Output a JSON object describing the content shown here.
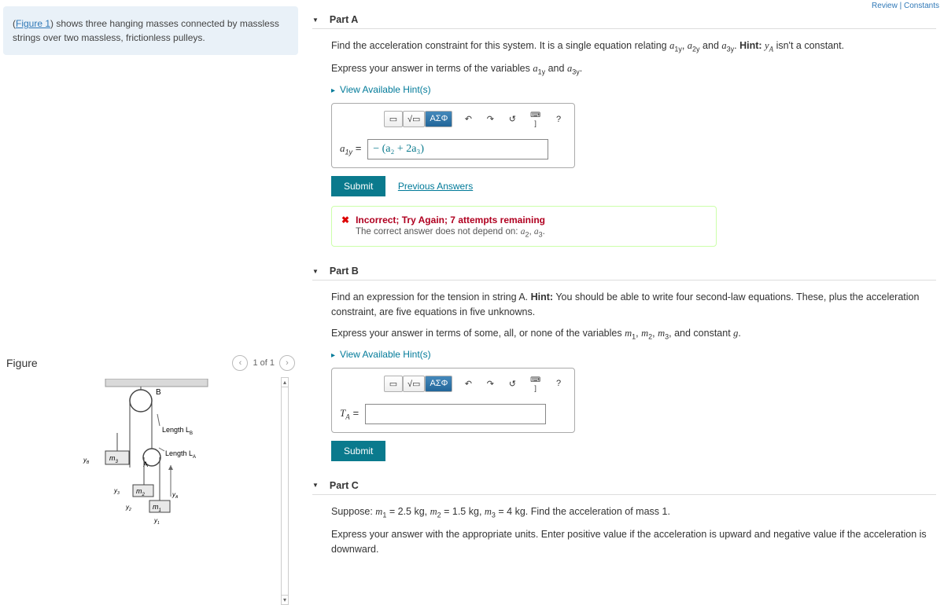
{
  "intro": {
    "figlink": "Figure 1",
    "text": ") shows three hanging masses connected by massless strings over two massless, frictionless pulleys."
  },
  "figure": {
    "title": "Figure",
    "position": "1 of 1",
    "labels": {
      "B": "B",
      "A": "A",
      "LB": "Length L",
      "LA": "Length L",
      "m1": "m",
      "m2": "m",
      "m3": "m",
      "y1": "y",
      "y2": "y",
      "y3": "y",
      "yA": "y",
      "yB": "y",
      "subA": "A",
      "subB": "B",
      "s1": "1",
      "s2": "2",
      "s3": "3"
    }
  },
  "partA": {
    "title": "Part A",
    "p1": "Find the acceleration constraint for this system. It is a single equation relating ",
    "v1": "a",
    "s1": "1y",
    "v2": "a",
    "s2": "2y",
    "v3": "a",
    "s3": "3y",
    "hintword": "Hint:",
    "hinttext": " y",
    "hintsub": "A",
    "hinttail": " isn't a constant.",
    "p2a": "Express your answer in terms of the variables ",
    "p2v1": "a",
    "p2s1": "1y",
    "p2and": " and ",
    "p2v2": "a",
    "p2s2": "3y",
    "p2dot": ".",
    "hintlink": "View Available Hint(s)",
    "lhs": "a",
    "lhssub": "1y",
    "eq": " = ",
    "answer": "− (a₂ + 2a₃)",
    "submit": "Submit",
    "prev": "Previous Answers",
    "fb_title": "Incorrect; Try Again; 7 attempts remaining",
    "fb_body": "The correct answer does not depend on: ",
    "fbv1": "a",
    "fbs1": "2",
    "fbv2": "a",
    "fbs2": "3",
    "fbdot": "."
  },
  "partB": {
    "title": "Part B",
    "p1": "Find an expression for the tension in string A. ",
    "hintword": "Hint:",
    "hinttext": " You should be able to write four second-law equations. These, plus the acceleration constraint, are five equations in five unknowns.",
    "p2a": "Express your answer in terms of some, all, or none of the variables ",
    "v1": "m",
    "s1": "1",
    "v2": "m",
    "s2": "2",
    "v3": "m",
    "s3": "3",
    "p2b": ", and constant ",
    "g": "g",
    "dot": ".",
    "hintlink": "View Available Hint(s)",
    "lhs": "T",
    "lhssub": "A",
    "eq": " = ",
    "submit": "Submit"
  },
  "partC": {
    "title": "Part C",
    "p1a": "Suppose: ",
    "v1": "m",
    "s1": "1",
    "eq1": " = 2.5 kg, ",
    "v2": "m",
    "s2": "2",
    "eq2": " = 1.5 kg, ",
    "v3": "m",
    "s3": "3",
    "eq3": " = 4 kg. Find the acceleration of mass 1.",
    "p2": "Express your answer with the appropriate units. Enter positive value if the acceleration is upward and negative value if the acceleration is downward."
  },
  "toolbar": {
    "templ": "▭",
    "sqrt": "√▭",
    "greek": "ΑΣΦ",
    "undo": "↶",
    "redo": "↷",
    "reset": "↺",
    "kb": "⌨ ]",
    "help": "?"
  }
}
